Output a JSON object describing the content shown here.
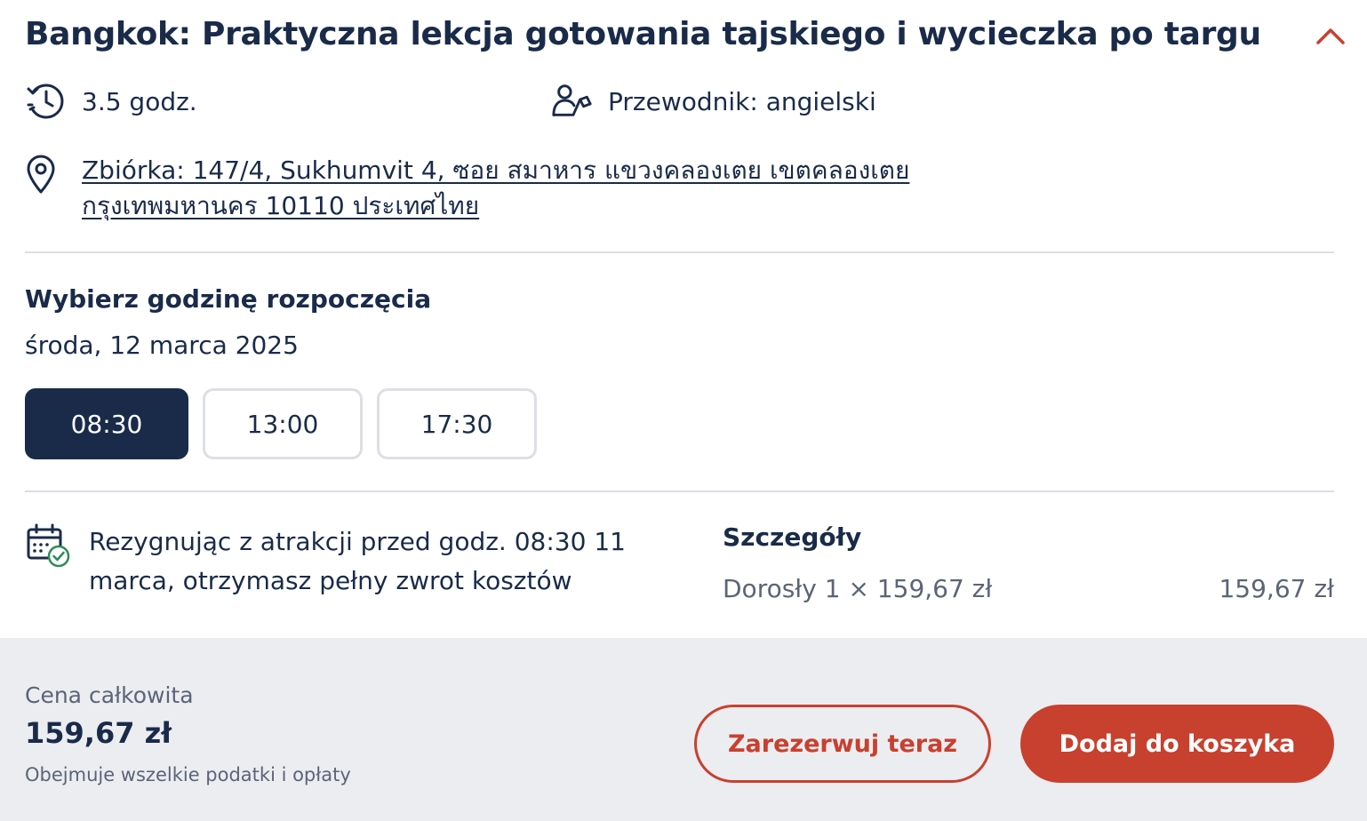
{
  "activity": {
    "title": "Bangkok: Praktyczna lekcja gotowania tajskiego i wycieczka po targu",
    "duration": "3.5 godz.",
    "guide": "Przewodnik: angielski",
    "meeting_point": "Zbiórka: 147/4, Sukhumvit 4, ซอย สมาหาร แขวงคลองเตย เขตคลองเตย กรุงเทพมหานคร 10110 ประเทศไทย"
  },
  "start_time": {
    "heading": "Wybierz godzinę rozpoczęcia",
    "date": "środa, 12 marca 2025",
    "slots": [
      {
        "label": "08:30",
        "selected": true
      },
      {
        "label": "13:00",
        "selected": false
      },
      {
        "label": "17:30",
        "selected": false
      }
    ]
  },
  "cancellation": {
    "text": "Rezygnując z atrakcji przed godz. 08:30 11 marca, otrzymasz pełny zwrot kosztów"
  },
  "details": {
    "heading": "Szczegóły",
    "line_label": "Dorosły 1 × 159,67 zł",
    "line_amount": "159,67 zł"
  },
  "footer": {
    "total_label": "Cena całkowita",
    "total_price": "159,67 zł",
    "tax_note": "Obejmuje wszelkie podatki i opłaty",
    "reserve_label": "Zarezerwuj teraz",
    "cart_label": "Dodaj do koszyka"
  },
  "colors": {
    "navy": "#1a2b49",
    "accent": "#c8402e",
    "muted": "#5b6478",
    "divider": "#dcdfe4",
    "footer_bg": "#ebedf1",
    "success": "#2e8b57"
  },
  "icons": {
    "collapse": "chevron-up-icon",
    "duration": "clock-history-icon",
    "guide": "guide-person-icon",
    "location": "map-pin-icon",
    "cancellation": "calendar-check-icon"
  }
}
